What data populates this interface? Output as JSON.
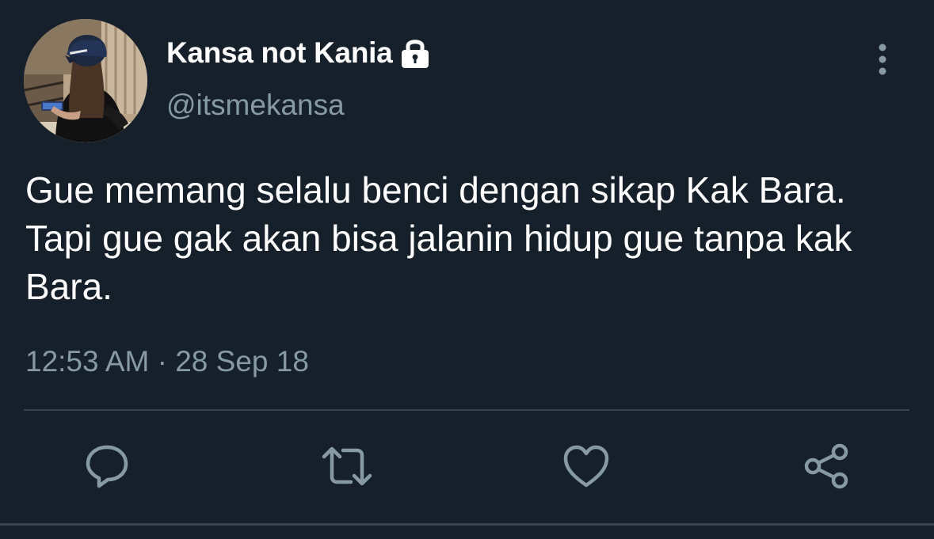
{
  "tweet": {
    "display_name": "Kansa not Kania",
    "handle": "@itsmekansa",
    "text": "Gue memang selalu benci dengan sikap Kak Bara. Tapi gue gak akan bisa jalanin hidup gue tanpa kak Bara.",
    "timestamp": "12:53 AM · 28 Sep 18"
  },
  "icons": {
    "account": "lock-icon",
    "menu": "more-vertical-icon",
    "actions": [
      "reply-icon",
      "retweet-icon",
      "like-icon",
      "share-icon"
    ]
  },
  "colors": {
    "background": "#15202b",
    "primary_text": "#ffffff",
    "secondary_text": "#8899a6",
    "divider": "#38444d"
  }
}
